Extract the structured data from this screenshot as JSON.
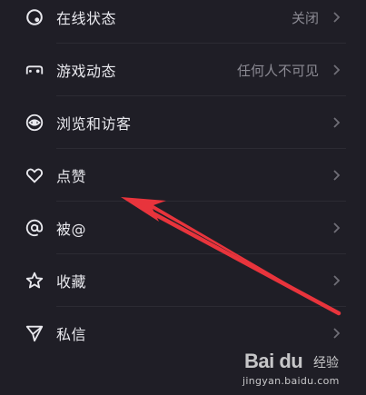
{
  "settings": {
    "items": [
      {
        "icon": "online-status-icon",
        "label": "在线状态",
        "value": "关闭"
      },
      {
        "icon": "gamepad-icon",
        "label": "游戏动态",
        "value": "任何人不可见"
      },
      {
        "icon": "eye-icon",
        "label": "浏览和访客",
        "value": ""
      },
      {
        "icon": "heart-icon",
        "label": "点赞",
        "value": ""
      },
      {
        "icon": "at-icon",
        "label": "被@",
        "value": ""
      },
      {
        "icon": "star-icon",
        "label": "收藏",
        "value": ""
      },
      {
        "icon": "send-icon",
        "label": "私信",
        "value": ""
      }
    ]
  },
  "watermark": {
    "logo": "Bai du",
    "text": "经验",
    "url": "jingyan.baidu.com"
  },
  "colors": {
    "background": "#1f1e26",
    "text": "#e9e9ee",
    "secondary": "#8b8a93",
    "arrow": "#e8343c"
  }
}
